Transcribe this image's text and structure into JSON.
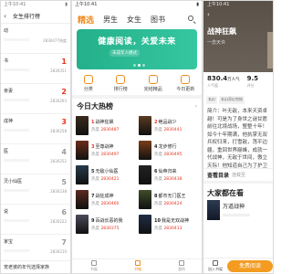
{
  "left": {
    "status_time": "上午10:41",
    "back_icon": "back-arrow-icon",
    "title": "女生排行榜",
    "items": [
      {
        "name": "动",
        "rank": "",
        "num": "2830477热度"
      },
      {
        "name": "书",
        "rank": "1",
        "num": "2830351"
      },
      {
        "name": "亲妻",
        "rank": "2",
        "num": "2830293"
      },
      {
        "name": "成神",
        "rank": "3",
        "num": "2830258"
      },
      {
        "name": "医",
        "rank": "4",
        "num": "2830252"
      },
      {
        "name": "灵小仙医",
        "rank": "5",
        "num": "2830238"
      },
      {
        "name": "说",
        "rank": "6",
        "num": "2830222"
      },
      {
        "name": "家宝",
        "rank": "7",
        "num": "2830210"
      }
    ],
    "bottom_text": "宠老婆的年代选择家族"
  },
  "middle": {
    "status_time": "上午10:41",
    "tabs": [
      "精选",
      "男生",
      "女生",
      "图书"
    ],
    "active_tab": "精选",
    "search_icon": "search-icon",
    "banner": {
      "title": "健康阅读，关爱未来",
      "subtitle": "未成年人模式"
    },
    "categories": [
      {
        "icon": "category-icon",
        "label": "分类"
      },
      {
        "icon": "ranking-icon",
        "label": "排行榜"
      },
      {
        "icon": "premium-icon",
        "label": "完结精品"
      },
      {
        "icon": "update-icon",
        "label": "今日更新"
      }
    ],
    "section_title": "今日大热榜",
    "more_label": "›",
    "books": [
      {
        "num": "1",
        "title": "战神狂飙",
        "heat_label": "热度",
        "heat": "2830487",
        "cover": "#3a2a1c"
      },
      {
        "num": "2",
        "title": "绝品战少",
        "heat_label": "热度",
        "heat": "2830441",
        "cover": "#5a3b22"
      },
      {
        "num": "3",
        "title": "至尊战神",
        "heat_label": "热度",
        "heat": "2830497",
        "cover": "#6b2e1a"
      },
      {
        "num": "4",
        "title": "龙步修行",
        "heat_label": "热度",
        "heat": "2830495",
        "cover": "#7a3d1a"
      },
      {
        "num": "5",
        "title": "无敌小仙医",
        "heat_label": "热度",
        "heat": "2830421",
        "cover": "#263a4a"
      },
      {
        "num": "6",
        "title": "仙帝归来",
        "heat_label": "热度",
        "heat": "2830438",
        "cover": "#222222"
      },
      {
        "num": "7",
        "title": "战狂成神",
        "heat_label": "热度",
        "heat": "2830460",
        "cover": "#5a2a20"
      },
      {
        "num": "8",
        "title": "都市无门医王",
        "heat_label": "热度",
        "heat": "2830424",
        "cover": "#3f4d2a"
      },
      {
        "num": "9",
        "title": "百战长恶的我",
        "heat_label": "热度",
        "heat": "2830375",
        "cover": "#4a4a5a"
      },
      {
        "num": "10",
        "title": "我是无双战神",
        "heat_label": "热度",
        "heat": "2830413",
        "cover": "#1f2e44"
      }
    ],
    "nav": [
      {
        "icon": "bookshelf-icon",
        "label": "书架"
      },
      {
        "icon": "bookstore-icon",
        "label": "书城"
      },
      {
        "icon": "profile-icon",
        "label": "我的"
      }
    ],
    "active_nav": "书城"
  },
  "right": {
    "status_time": "上午10:41",
    "back_icon": "back-arrow-icon",
    "title": "战神狂飙",
    "author": "一念天许",
    "stats": [
      {
        "value": "830.4",
        "unit": "万人气",
        "label": "人气值"
      },
      {
        "value": "9.5",
        "unit": "",
        "label": "评分"
      }
    ],
    "tags": [
      "玄幻",
      "玄幻奇幻完结"
    ],
    "description": "简介：叶无敌，本来天资卓越！可是为了身世之谜甘愿前往北境战场，整整十年！如今十年期满，他执掌无双兵权归来，打雪敌，荡平边疆，重回世界巅峰，成就一代战神，无敌于世间，傲立天际！他知道自己为了护卫叶家，不惜与天下为敌，都市风云，分和权...",
    "directory_label": "查看目录",
    "directory_status": "连载至",
    "also_reading": "大家都在看",
    "rec_title": "万道战神",
    "shelf_label": "加入书架",
    "read_label": "免费阅读"
  }
}
